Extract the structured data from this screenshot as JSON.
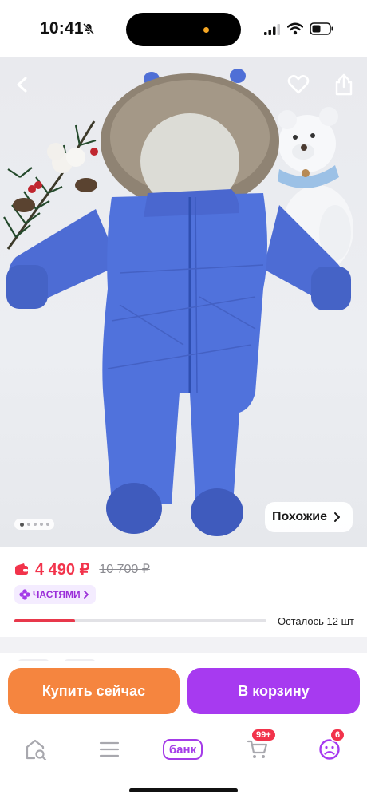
{
  "status_bar": {
    "time": "10:41"
  },
  "hero": {
    "image_alt": "Синий зимний детский комбинезон с меховым капюшоном",
    "slides_total": 5,
    "slide_active": 1,
    "similar_label": "Похожие"
  },
  "product": {
    "price": "4 490 ₽",
    "old_price": "10 700 ₽",
    "installments_label": "ЧАСТЯМИ",
    "stock_text": "Осталось 12 шт",
    "stock_fraction": 0.24
  },
  "actions": {
    "buy_now": "Купить сейчас",
    "add_to_cart": "В корзину"
  },
  "tabbar": {
    "bank_label": "банк",
    "cart_badge": "99+",
    "profile_badge": "6"
  },
  "colors": {
    "price": "#f2334b",
    "buy": "#f5853f",
    "cart": "#a73af0",
    "accent": "#a43be8",
    "suit": "#4f6fd6"
  },
  "icons": {
    "back": "chevron-left-icon",
    "favorite": "heart-icon",
    "share": "share-icon",
    "wallet": "wallet-icon",
    "parts": "flower-icon",
    "home": "home-search-icon",
    "catalog": "menu-icon",
    "cart": "cart-icon",
    "profile": "profile-icon"
  }
}
